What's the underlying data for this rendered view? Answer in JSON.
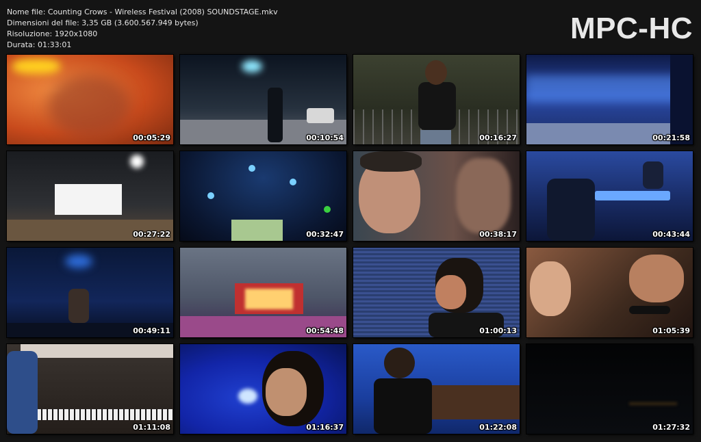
{
  "info": {
    "filename": "Nome file: Counting Crows - Wireless Festival (2008) SOUNDSTAGE.mkv",
    "filesize": "Dimensioni del file: 3,35 GB (3.600.567.949 bytes)",
    "resolution": "Risoluzione: 1920x1080",
    "duration": "Durata: 01:33:01"
  },
  "logo": "MPC-HC",
  "thumbnails": [
    {
      "time": "00:05:29",
      "bg": "#d35a24",
      "accent": "#ffd020"
    },
    {
      "time": "00:10:54",
      "bg": "#1b2430",
      "accent": "#7fe0ff"
    },
    {
      "time": "00:16:27",
      "bg": "#2c3124",
      "accent": "#c8b070"
    },
    {
      "time": "00:21:58",
      "bg": "#1a2d6a",
      "accent": "#4fa0ff"
    },
    {
      "time": "00:27:22",
      "bg": "#2a2c30",
      "accent": "#ffffff"
    },
    {
      "time": "00:32:47",
      "bg": "#0d1d3c",
      "accent": "#39b7ff"
    },
    {
      "time": "00:38:17",
      "bg": "#3a4650",
      "accent": "#d9a890"
    },
    {
      "time": "00:43:44",
      "bg": "#1b3270",
      "accent": "#4a9cff"
    },
    {
      "time": "00:49:11",
      "bg": "#0c1a3c",
      "accent": "#2d6bd8"
    },
    {
      "time": "00:54:48",
      "bg": "#505868",
      "accent": "#ff5aa0"
    },
    {
      "time": "01:00:13",
      "bg": "#2a3e70",
      "accent": "#e0a050"
    },
    {
      "time": "01:05:39",
      "bg": "#3e2a1e",
      "accent": "#d08860"
    },
    {
      "time": "01:11:08",
      "bg": "#2e2824",
      "accent": "#3a6ab0"
    },
    {
      "time": "01:16:37",
      "bg": "#1225a8",
      "accent": "#a0d0ff"
    },
    {
      "time": "01:22:08",
      "bg": "#1a3e9e",
      "accent": "#f0d0a0"
    },
    {
      "time": "01:27:32",
      "bg": "#050608",
      "accent": "#302010"
    }
  ]
}
